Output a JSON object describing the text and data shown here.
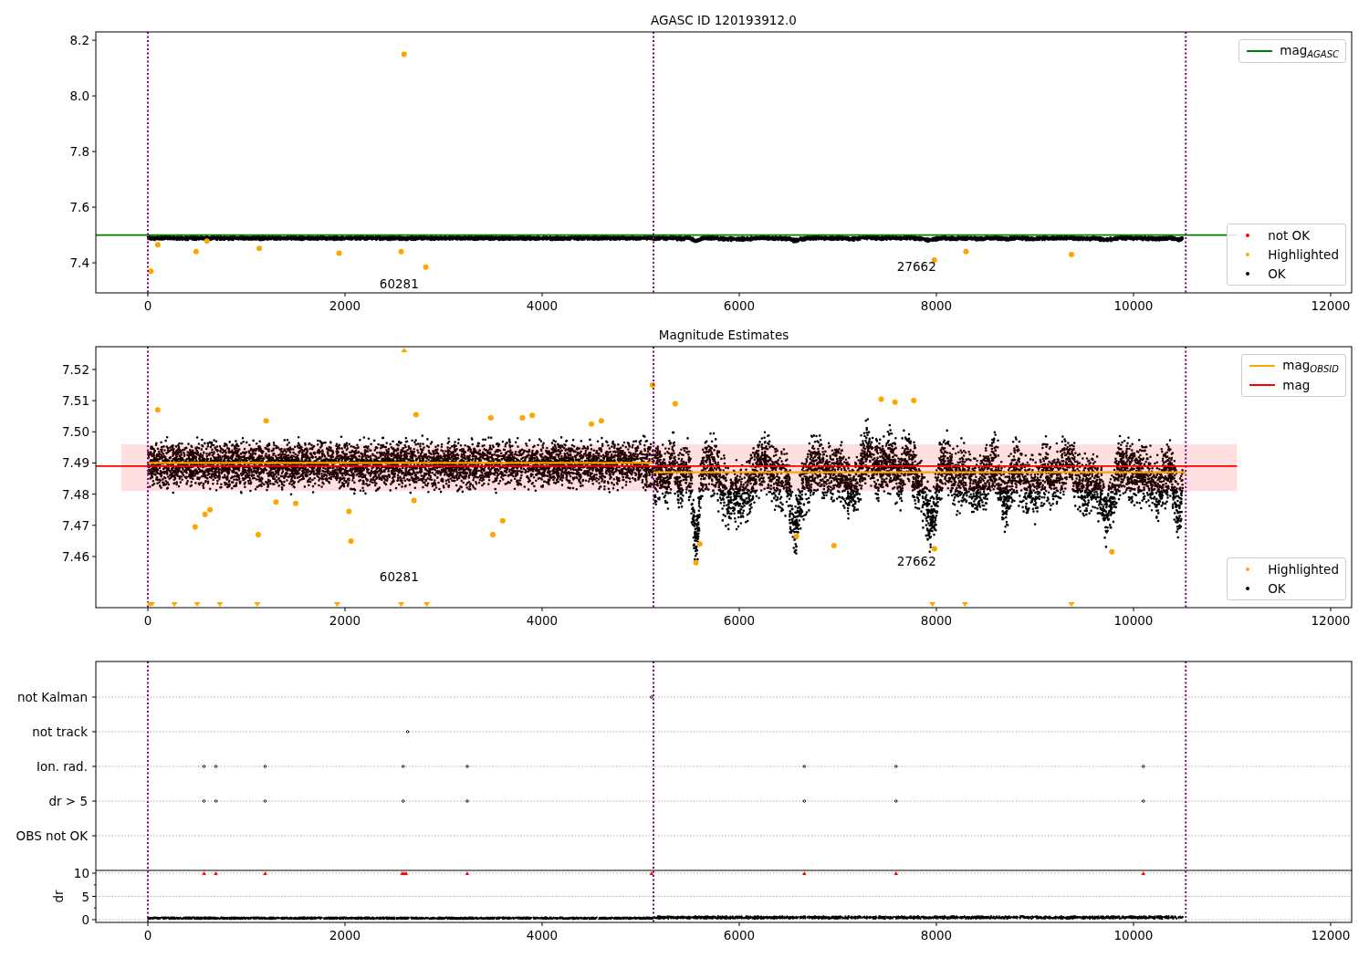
{
  "panels": [
    {
      "chart_data": {
        "type": "scatter",
        "title": "AGASC ID 120193912.0",
        "xlim": [
          -528,
          12213
        ],
        "ylim": [
          7.292,
          8.23
        ],
        "xticks": [
          0,
          2000,
          4000,
          6000,
          8000,
          10000,
          12000
        ],
        "yticks": [
          {
            "value": 7.4,
            "label": "7.4"
          },
          {
            "value": 7.6,
            "label": "7.6"
          },
          {
            "value": 7.8,
            "label": "7.8"
          },
          {
            "value": 8.0,
            "label": "8.0"
          },
          {
            "value": 8.2,
            "label": "8.2"
          }
        ],
        "x": [
          30,
          100,
          490,
          600,
          1130,
          1940,
          2570,
          2600,
          2820,
          7980,
          8300,
          9370
        ],
        "series": [
          {
            "name": "Highlighted",
            "color": "#ffa500",
            "values": [
              7.37,
              7.465,
              7.44,
              7.478,
              7.452,
              7.435,
              7.44,
              8.15,
              7.385,
              7.41,
              7.44,
              7.43
            ]
          }
        ],
        "ref_lines": [
          {
            "axis": "y",
            "value": 7.5,
            "color": "#008000"
          },
          {
            "axis": "x",
            "value": 0,
            "color": "#800080"
          },
          {
            "axis": "x",
            "value": 5130,
            "color": "#800080"
          },
          {
            "axis": "x",
            "value": 10530,
            "color": "#800080"
          }
        ],
        "annotations": [
          {
            "text": "60281"
          },
          {
            "text": "27662"
          }
        ]
      },
      "legends": [
        {
          "entries": [
            {
              "label": "mag$_{AGASC}$",
              "kind": "line",
              "color": "#008000"
            }
          ]
        },
        {
          "entries": [
            {
              "label": "not OK",
              "kind": "dot",
              "color": "#ff0000"
            },
            {
              "kind": "series"
            },
            {
              "label": "OK",
              "kind": "dot",
              "color": "#000000"
            }
          ]
        }
      ]
    },
    {
      "chart_data": {
        "type": "scatter",
        "title": "Magnitude Estimates",
        "xlim": [
          -528,
          12213
        ],
        "ylim": [
          7.4436,
          7.5273
        ],
        "xticks": [
          0,
          2000,
          4000,
          6000,
          8000,
          10000,
          12000
        ],
        "yticks": [
          {
            "value": 7.46,
            "label": "7.46"
          },
          {
            "value": 7.47,
            "label": "7.47"
          },
          {
            "value": 7.48,
            "label": "7.48"
          },
          {
            "value": 7.49,
            "label": "7.49"
          },
          {
            "value": 7.5,
            "label": "7.50"
          },
          {
            "value": 7.51,
            "label": "7.51"
          },
          {
            "value": 7.52,
            "label": "7.52"
          }
        ],
        "x": [
          100,
          480,
          580,
          630,
          1120,
          1200,
          1300,
          1500,
          2040,
          2060,
          2700,
          2720,
          3480,
          3500,
          3600,
          3800,
          3900,
          4500,
          4600,
          5120,
          5350,
          5560,
          5600,
          6580,
          6960,
          7440,
          7580,
          7770,
          7980,
          9780
        ],
        "series": [
          {
            "name": "Highlighted",
            "color": "#ffa500",
            "values": [
              7.507,
              7.4695,
              7.4735,
              7.475,
              7.467,
              7.5035,
              7.4775,
              7.477,
              7.4745,
              7.465,
              7.478,
              7.5055,
              7.5045,
              7.467,
              7.4715,
              7.5045,
              7.5053,
              7.5025,
              7.5035,
              7.515,
              7.509,
              7.458,
              7.464,
              7.4665,
              7.4635,
              7.5105,
              7.5095,
              7.51,
              7.4625,
              7.4615
            ]
          }
        ],
        "ref_lines": [
          {
            "axis": "y",
            "value": 7.489,
            "color": "#ff0000"
          },
          {
            "axis": "y",
            "value": 7.49,
            "color": "#ffa500"
          },
          {
            "axis": "y",
            "value": 7.487,
            "color": "#ffa500"
          },
          {
            "axis": "x",
            "value": 0,
            "color": "#800080"
          },
          {
            "axis": "x",
            "value": 5130,
            "color": "#800080"
          },
          {
            "axis": "x",
            "value": 10530,
            "color": "#800080"
          }
        ],
        "bands": [
          {
            "axis": "y",
            "from": 7.481,
            "to": 7.496,
            "color": "#ff0000"
          }
        ],
        "annotations": [
          {
            "text": "60281"
          },
          {
            "text": "27662"
          }
        ]
      },
      "legends": [
        {
          "entries": [
            {
              "label": "mag$_{OBSID}$",
              "kind": "line",
              "color": "#ffa500"
            },
            {
              "label": "mag",
              "kind": "line",
              "color": "#ff0000"
            }
          ]
        },
        {
          "entries": [
            {
              "kind": "series"
            },
            {
              "label": "OK",
              "kind": "dot",
              "color": "#000000"
            }
          ]
        }
      ]
    },
    {
      "flag_rows": [
        {
          "label": "not Kalman"
        },
        {
          "label": "not track"
        },
        {
          "label": "Ion. rad."
        },
        {
          "label": "dr > 5"
        },
        {
          "label": "OBS not OK"
        }
      ],
      "dr_axis": {
        "label": "dr",
        "ticks": [
          "10",
          "5",
          "0"
        ]
      },
      "xtick_labels": [
        "0",
        "2000",
        "4000",
        "6000",
        "8000",
        "10000",
        "12000"
      ]
    }
  ]
}
